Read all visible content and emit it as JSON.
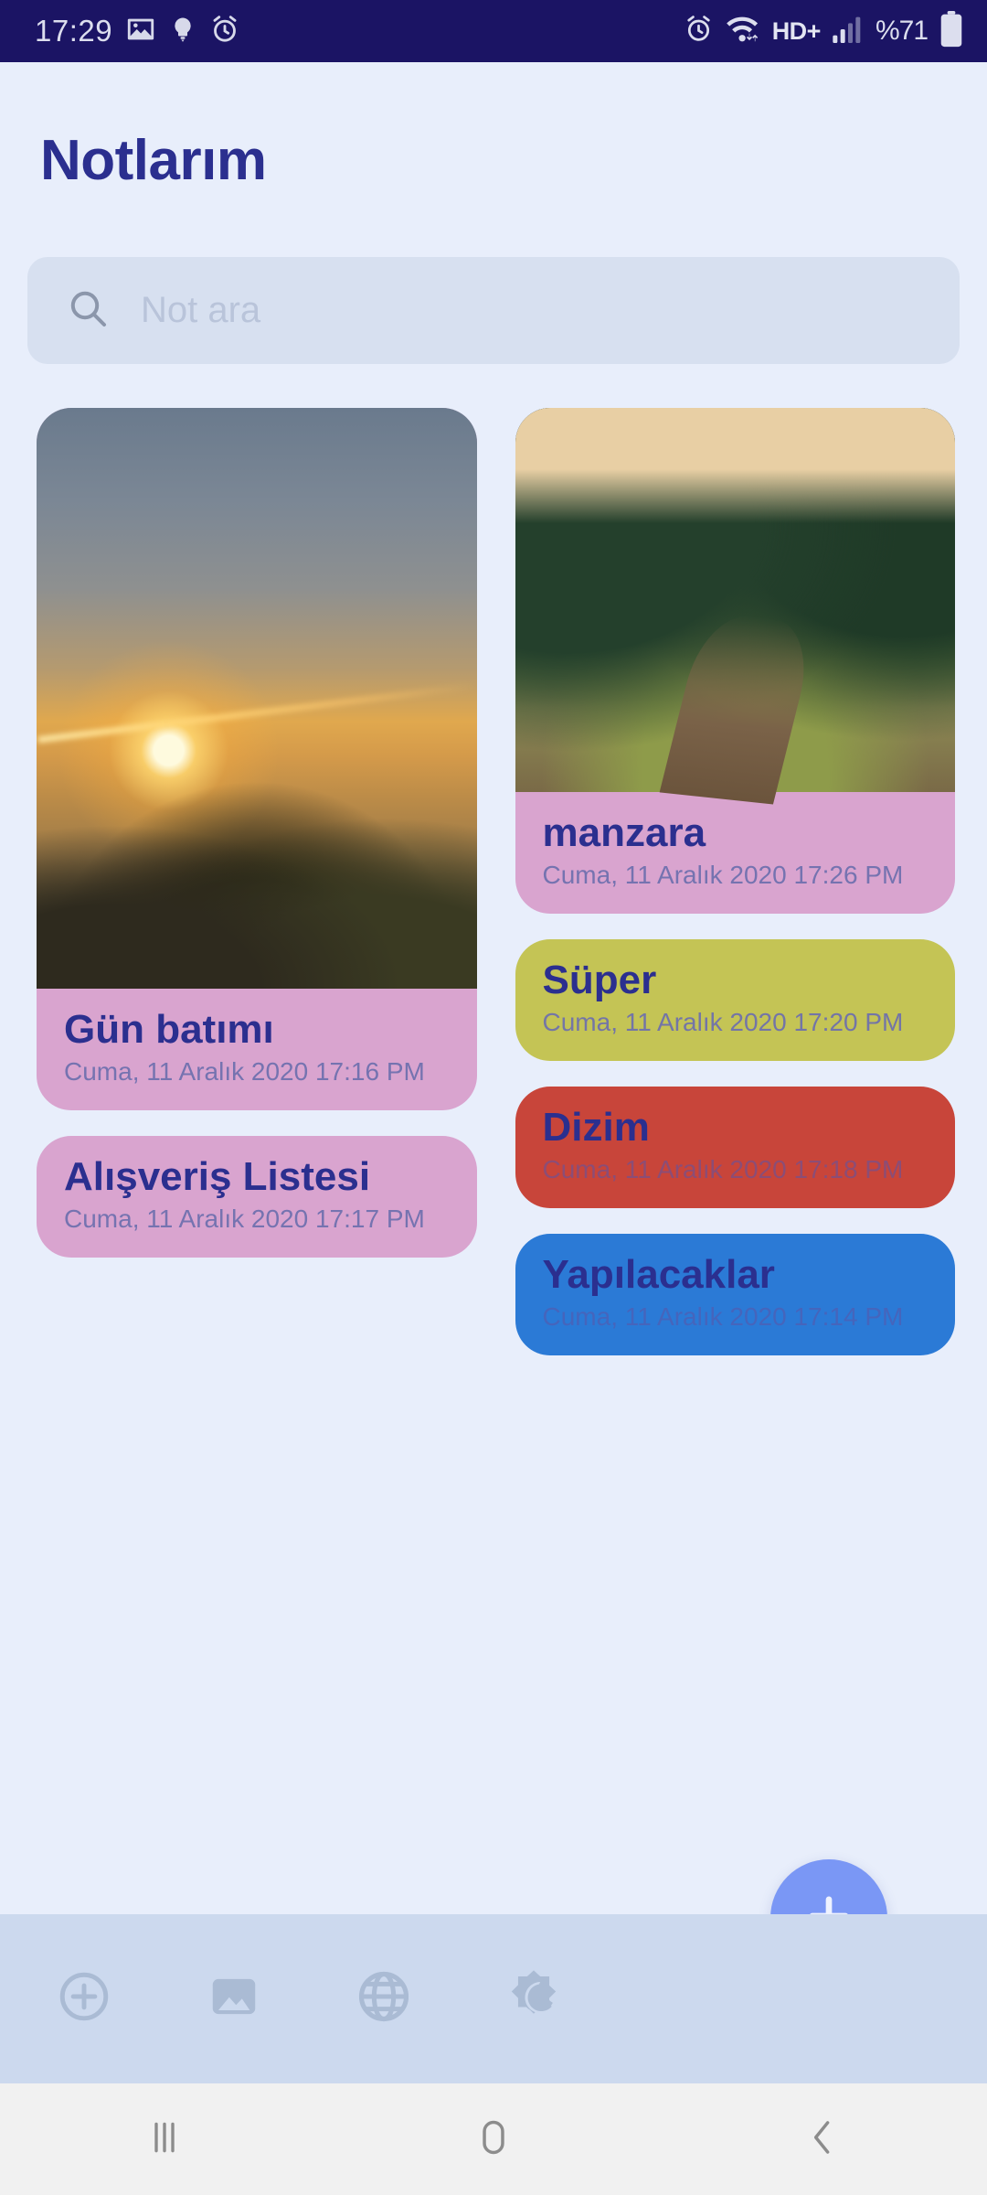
{
  "status_bar": {
    "clock": "17:29",
    "left_icons": [
      "image-icon",
      "lightbulb-icon",
      "alarm-icon"
    ],
    "network_label": "HD+",
    "battery_label": "%71",
    "right_icons": [
      "alarm-icon",
      "wifi-icon",
      "signal-icon",
      "battery-icon"
    ],
    "background_color": "#1b1464"
  },
  "header": {
    "title": "Notlarım",
    "title_color": "#2b2f8f"
  },
  "search": {
    "placeholder": "Not ara",
    "value": "",
    "icon": "search-icon",
    "background_color": "#d7e0f0"
  },
  "notes": {
    "left_column": [
      {
        "title": "Gün batımı",
        "date": "Cuma, 11 Aralık 2020 17:16 PM",
        "color": "#d9a4cf",
        "has_photo": true,
        "photo": "sunset-over-sea-photo",
        "text_color": "#2b2f8f"
      },
      {
        "title": "Alışveriş Listesi",
        "date": "Cuma, 11 Aralık 2020 17:17 PM",
        "color": "#d9a4cf",
        "has_photo": false,
        "photo": "",
        "text_color": "#2b2f8f"
      }
    ],
    "right_column": [
      {
        "title": "manzara",
        "date": "Cuma, 11 Aralık 2020 17:26 PM",
        "color": "#d9a4cf",
        "has_photo": true,
        "photo": "forest-railway-photo",
        "text_color": "#2b2f8f"
      },
      {
        "title": "Süper",
        "date": "Cuma, 11 Aralık 2020 17:20 PM",
        "color": "#c4c455",
        "has_photo": false,
        "photo": "",
        "text_color": "#2b2f8f"
      },
      {
        "title": "Dizim",
        "date": "Cuma, 11 Aralık 2020 17:18 PM",
        "color": "#c8453a",
        "has_photo": false,
        "photo": "",
        "text_color": "#2b2f8f"
      },
      {
        "title": "Yapılacaklar",
        "date": "Cuma, 11 Aralık 2020 17:14 PM",
        "color": "#2b7ad6",
        "has_photo": false,
        "photo": "",
        "text_color": "#2b2f8f"
      }
    ]
  },
  "fab": {
    "icon": "plus-icon",
    "color": "#7a97f5",
    "label": "+"
  },
  "toolbar": {
    "background_color": "#ccd9ee",
    "icon_color": "#aabbd4",
    "items": [
      {
        "icon": "plus-circle-icon",
        "name": "add-note-button"
      },
      {
        "icon": "image-icon",
        "name": "add-image-button"
      },
      {
        "icon": "globe-icon",
        "name": "web-button"
      },
      {
        "icon": "dark-mode-icon",
        "name": "theme-toggle-button"
      }
    ]
  },
  "navigation_bar": {
    "background_color": "#f1f1f1",
    "items": [
      {
        "icon": "recents-icon",
        "name": "recents-button"
      },
      {
        "icon": "home-icon",
        "name": "home-button"
      },
      {
        "icon": "back-icon",
        "name": "back-button"
      }
    ]
  },
  "page": {
    "background_color": "#e8eefb"
  }
}
